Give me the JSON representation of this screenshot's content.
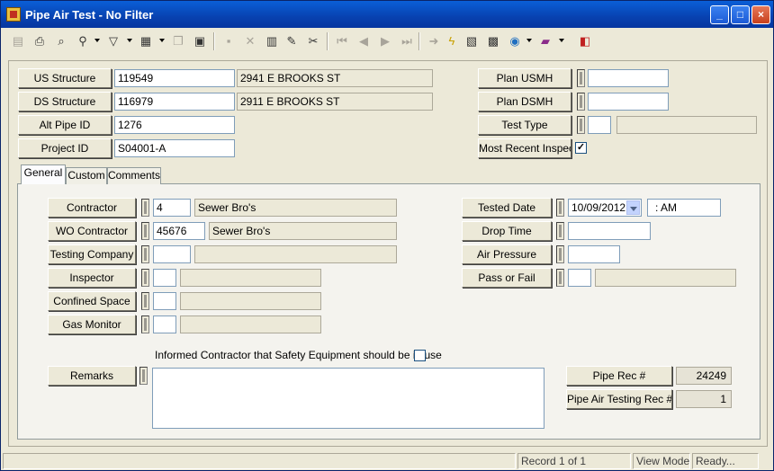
{
  "window": {
    "title": "Pipe Air Test - No Filter",
    "minimize": "_",
    "maximize": "□",
    "close": "×"
  },
  "toolbar": {
    "icons": [
      "new-record-icon",
      "print-icon",
      "print-preview-icon",
      "find-icon",
      "filter-icon",
      "form-view-icon",
      "copy-icon",
      "paste-icon",
      "save-icon",
      "delete-icon",
      "records-icon",
      "edit-icon",
      "cut-icon",
      "first-record-icon",
      "prev-record-icon",
      "next-record-icon",
      "last-record-icon",
      "go-icon",
      "lightning-icon",
      "lookup-icon",
      "tree-icon",
      "globe-icon",
      "books-icon",
      "exit-icon"
    ],
    "glyphs": {
      "new-record-icon": "▤",
      "print-icon": "⎙",
      "print-preview-icon": "⌕",
      "find-icon": "⚲",
      "filter-icon": "▽",
      "form-view-icon": "▦",
      "copy-icon": "❐",
      "paste-icon": "▣",
      "save-icon": "▪",
      "delete-icon": "✕",
      "records-icon": "▥",
      "edit-icon": "✎",
      "cut-icon": "✂",
      "first-record-icon": "⏮",
      "prev-record-icon": "◀",
      "next-record-icon": "▶",
      "last-record-icon": "⏭",
      "go-icon": "➜",
      "lightning-icon": "ϟ",
      "lookup-icon": "▧",
      "tree-icon": "▩",
      "globe-icon": "◉",
      "books-icon": "▰",
      "exit-icon": "◧"
    }
  },
  "header": {
    "us_structure": {
      "label": "US Structure",
      "id": "119549",
      "address": "2941  E  BROOKS ST"
    },
    "ds_structure": {
      "label": "DS Structure",
      "id": "116979",
      "address": "2911  E BROOKS ST"
    },
    "alt_pipe_id": {
      "label": "Alt Pipe ID",
      "value": "1276"
    },
    "project_id": {
      "label": "Project ID",
      "value": "S04001-A"
    },
    "plan_usmh": {
      "label": "Plan USMH",
      "value": ""
    },
    "plan_dsmh": {
      "label": "Plan DSMH",
      "value": ""
    },
    "test_type": {
      "label": "Test Type",
      "code": "",
      "desc": ""
    },
    "most_recent": {
      "label": "Most Recent Inspect",
      "checked": "✓"
    }
  },
  "tabs": [
    "General",
    "Custom",
    "Comments"
  ],
  "general": {
    "contractor": {
      "label": "Contractor",
      "code": "4",
      "name": "Sewer Bro's"
    },
    "wo_contractor": {
      "label": "WO Contractor",
      "code": "45676",
      "name": "Sewer Bro's"
    },
    "testing_company": {
      "label": "Testing Company",
      "code": "",
      "name": ""
    },
    "inspector": {
      "label": "Inspector",
      "code": "",
      "name": ""
    },
    "confined_space": {
      "label": "Confined Space",
      "code": "",
      "name": ""
    },
    "gas_monitor": {
      "label": "Gas Monitor",
      "code": "",
      "name": ""
    },
    "tested_date": {
      "label": "Tested Date",
      "date": "10/09/2012",
      "time": " :  AM"
    },
    "drop_time": {
      "label": "Drop Time",
      "value": ""
    },
    "air_pressure": {
      "label": "Air Pressure",
      "value": ""
    },
    "pass_or_fail": {
      "label": "Pass or Fail",
      "code": "",
      "desc": ""
    },
    "informed_contractor": {
      "label": "Informed Contractor that Safety Equipment should be in use",
      "checked": ""
    },
    "remarks": {
      "label": "Remarks",
      "value": ""
    },
    "pipe_rec": {
      "label": "Pipe Rec #",
      "value": "24249"
    },
    "pipe_air_testing_rec": {
      "label": "Pipe Air Testing Rec #",
      "value": "1"
    }
  },
  "status": {
    "record": "Record 1 of 1",
    "mode": "View Mode",
    "state": "Ready..."
  }
}
